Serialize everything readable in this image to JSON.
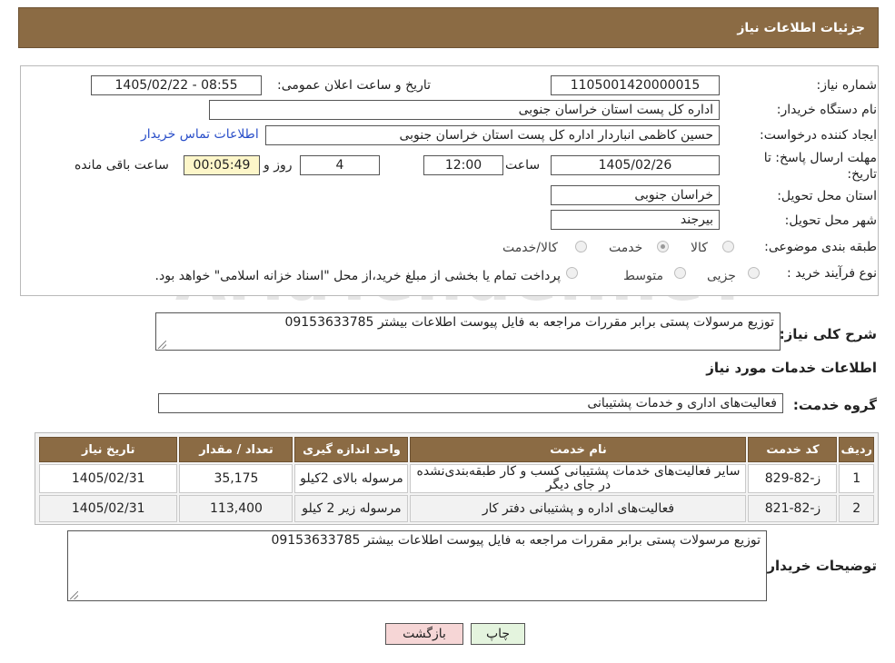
{
  "header": {
    "title": "جزئیات اطلاعات نیاز"
  },
  "form": {
    "need_number_label": "شماره نیاز:",
    "need_number": "1105001420000015",
    "announce_label": "تاریخ و ساعت اعلان عمومی:",
    "announce_value": "1405/02/22 - 08:55",
    "buyer_label": "نام دستگاه خریدار:",
    "buyer_value": "اداره کل پست استان خراسان جنوبی",
    "creator_label": "ایجاد کننده درخواست:",
    "creator_value": "حسین کاظمی انباردار اداره کل پست استان خراسان جنوبی",
    "contact_link": "اطلاعات تماس خریدار",
    "deadline_label": "مهلت ارسال پاسخ: تا تاریخ:",
    "deadline_date": "1405/02/26",
    "time_label": "ساعت",
    "deadline_time": "12:00",
    "days_value": "4",
    "days_label": "روز و",
    "remaining_value": "00:05:49",
    "remaining_label": "ساعت باقی مانده",
    "province_label": "استان محل تحویل:",
    "province_value": "خراسان جنوبی",
    "city_label": "شهر محل تحویل:",
    "city_value": "بیرجند",
    "category_label": "طبقه بندی موضوعی:",
    "category_options": [
      "کالا",
      "خدمت",
      "کالا/خدمت"
    ],
    "category_selected": "خدمت",
    "process_label": "نوع فرآیند خرید :",
    "process_options": [
      "جزیی",
      "متوسط"
    ],
    "process_note": "پرداخت تمام یا بخشی از مبلغ خرید،از محل \"اسناد خزانه اسلامی\" خواهد بود."
  },
  "summary": {
    "label": "شرح کلی نیاز:",
    "value": "توزیع مرسولات پستی برابر مقررات مراجعه به فایل پیوست اطلاعات بیشتر 09153633785"
  },
  "services": {
    "section_title": "اطلاعات خدمات مورد نیاز",
    "group_label": "گروه خدمت:",
    "group_value": "فعالیت‌های اداری و خدمات پشتیبانی"
  },
  "table": {
    "headers": [
      "ردیف",
      "کد خدمت",
      "نام خدمت",
      "واحد اندازه گیری",
      "تعداد / مقدار",
      "تاریخ نیاز"
    ],
    "rows": [
      [
        "1",
        "ز-82-829",
        "سایر فعالیت‌های خدمات پشتیبانی کسب و کار طبقه‌بندی‌نشده در جای دیگر",
        "مرسوله بالای 2کیلو",
        "35,175",
        "1405/02/31"
      ],
      [
        "2",
        "ز-82-821",
        "فعالیت‌های اداره و پشتیبانی دفتر کار",
        "مرسوله زیر 2 کیلو",
        "113,400",
        "1405/02/31"
      ]
    ]
  },
  "buyer_notes": {
    "label": "توضیحات خریدار:",
    "value": "توزیع مرسولات پستی برابر مقررات مراجعه به فایل پیوست اطلاعات بیشتر 09153633785"
  },
  "buttons": {
    "print": "چاپ",
    "back": "بازگشت"
  },
  "watermark": "AriaTender.neT",
  "colors": {
    "header_bg": "#8b6b44",
    "timer_bg": "#fdf6c9",
    "back_btn_bg": "#f6d6d6",
    "print_btn_bg": "#e4f4de",
    "link": "#2a4fc9"
  }
}
